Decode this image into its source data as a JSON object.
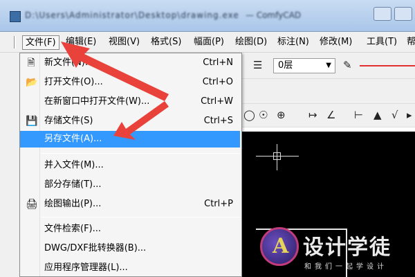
{
  "window": {
    "title": "D:\\Users\\Administrator\\Desktop\\drawing.exe",
    "title_suffix": "— ComfyCAD"
  },
  "menubar": {
    "items": [
      {
        "label": "文件(F)",
        "active": true
      },
      {
        "label": "编辑(E)"
      },
      {
        "label": "视图(V)"
      },
      {
        "label": "格式(S)"
      },
      {
        "label": "幅面(P)"
      },
      {
        "label": "绘图(D)"
      },
      {
        "label": "标注(N)"
      },
      {
        "label": "修改(M)"
      },
      {
        "label": "工具(T)"
      },
      {
        "label": "帮"
      }
    ]
  },
  "toolbar": {
    "layer_value": "0层",
    "line_color": "#e03030"
  },
  "file_menu": {
    "items": [
      {
        "label": "新文件(N)...",
        "shortcut": "Ctrl+N",
        "icon": "new-file-icon"
      },
      {
        "label": "打开文件(O)...",
        "shortcut": "Ctrl+O",
        "icon": "open-folder-icon"
      },
      {
        "label": "在新窗口中打开文件(W)...",
        "shortcut": "Ctrl+W",
        "icon": ""
      },
      {
        "label": "存储文件(S)",
        "shortcut": "Ctrl+S",
        "icon": "save-disk-icon"
      },
      {
        "label": "另存文件(A)...",
        "shortcut": "",
        "icon": "",
        "highlighted": true
      },
      {
        "label": "并入文件(M)...",
        "shortcut": "",
        "icon": ""
      },
      {
        "label": "部分存储(T)...",
        "shortcut": "",
        "icon": ""
      },
      {
        "label": "绘图输出(P)...",
        "shortcut": "Ctrl+P",
        "icon": "printer-icon"
      },
      {
        "label": "文件检索(F)...",
        "shortcut": "",
        "icon": ""
      },
      {
        "label": "DWG/DXF批转换器(B)...",
        "shortcut": "",
        "icon": ""
      },
      {
        "label": "应用程序管理器(L)...",
        "shortcut": "",
        "icon": ""
      }
    ]
  },
  "watermark": {
    "logo_letter": "A",
    "text": "设计学徒",
    "subtext": "和我们一起学设计"
  },
  "colors": {
    "highlight": "#3399ff",
    "arrow": "#e8423b"
  }
}
